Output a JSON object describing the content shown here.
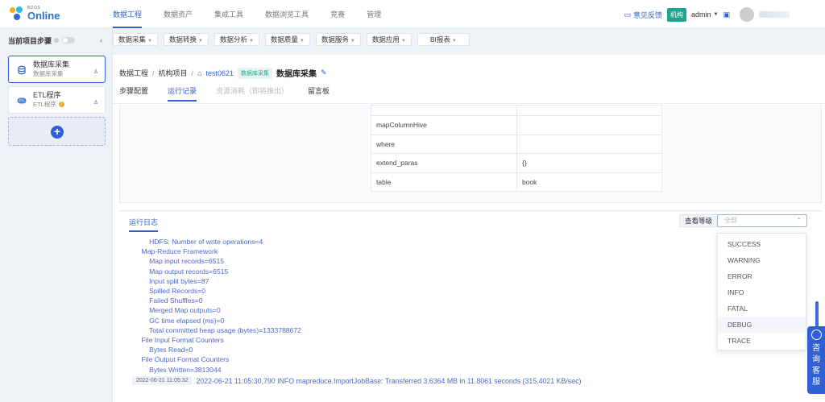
{
  "app": {
    "logo_small": "BDOS",
    "logo_big": "Online"
  },
  "nav": [
    "数据工程",
    "数据资产",
    "集成工具",
    "数据浏览工具",
    "竞赛",
    "管理"
  ],
  "header_right": {
    "feedback": "意见反馈",
    "org": "机构",
    "user": "admin"
  },
  "left_panel": {
    "title": "当前项目步骤",
    "steps": [
      {
        "title": "数据库采集",
        "subtitle": "数据库采集"
      },
      {
        "title": "ETL程序",
        "subtitle": "ETL程序"
      }
    ]
  },
  "categories": [
    "数据采集",
    "数据转换",
    "数据分析",
    "数据质量",
    "数据服务",
    "数据应用",
    "BI报表"
  ],
  "breadcrumb": {
    "root": "数据工程",
    "project": "机构项目",
    "home": "test0621",
    "tag": "数据库采集",
    "title": "数据库采集"
  },
  "tabs": [
    "步骤配置",
    "运行记录",
    "资源消耗（即将推出）",
    "留言板"
  ],
  "params": [
    {
      "key": "mapColumnHive",
      "value": ""
    },
    {
      "key": "where",
      "value": ""
    },
    {
      "key": "extend_paras",
      "value": "{}"
    },
    {
      "key": "table",
      "value": "book"
    }
  ],
  "log": {
    "tab": "运行日志",
    "level_label": "查看等级",
    "level_placeholder": "全部",
    "lines": [
      "        HDFS: Number of write operations=4",
      "    Map-Reduce Framework",
      "        Map input records=6515",
      "        Map output records=6515",
      "        Input split bytes=87",
      "        Spilled Records=0",
      "        Failed Shuffles=0",
      "        Merged Map outputs=0",
      "        GC time elapsed (ms)=0",
      "        Total committed heap usage (bytes)=1333788672",
      "    File Input Format Counters",
      "        Bytes Read=0",
      "    File Output Format Counters",
      "        Bytes Written=3813044"
    ],
    "final_timestamp": "2022-06-21 11:05:32",
    "final_line": "2022-06-21 11:05:30,790 INFO mapreduce.ImportJobBase: Transferred 3.6364 MB in 11.8061 seconds (315.4021 KB/sec)"
  },
  "levels": [
    "SUCCESS",
    "WARNING",
    "ERROR",
    "INFO",
    "FATAL",
    "DEBUG",
    "TRACE"
  ],
  "consult": [
    "咨",
    "询",
    "客",
    "服"
  ]
}
